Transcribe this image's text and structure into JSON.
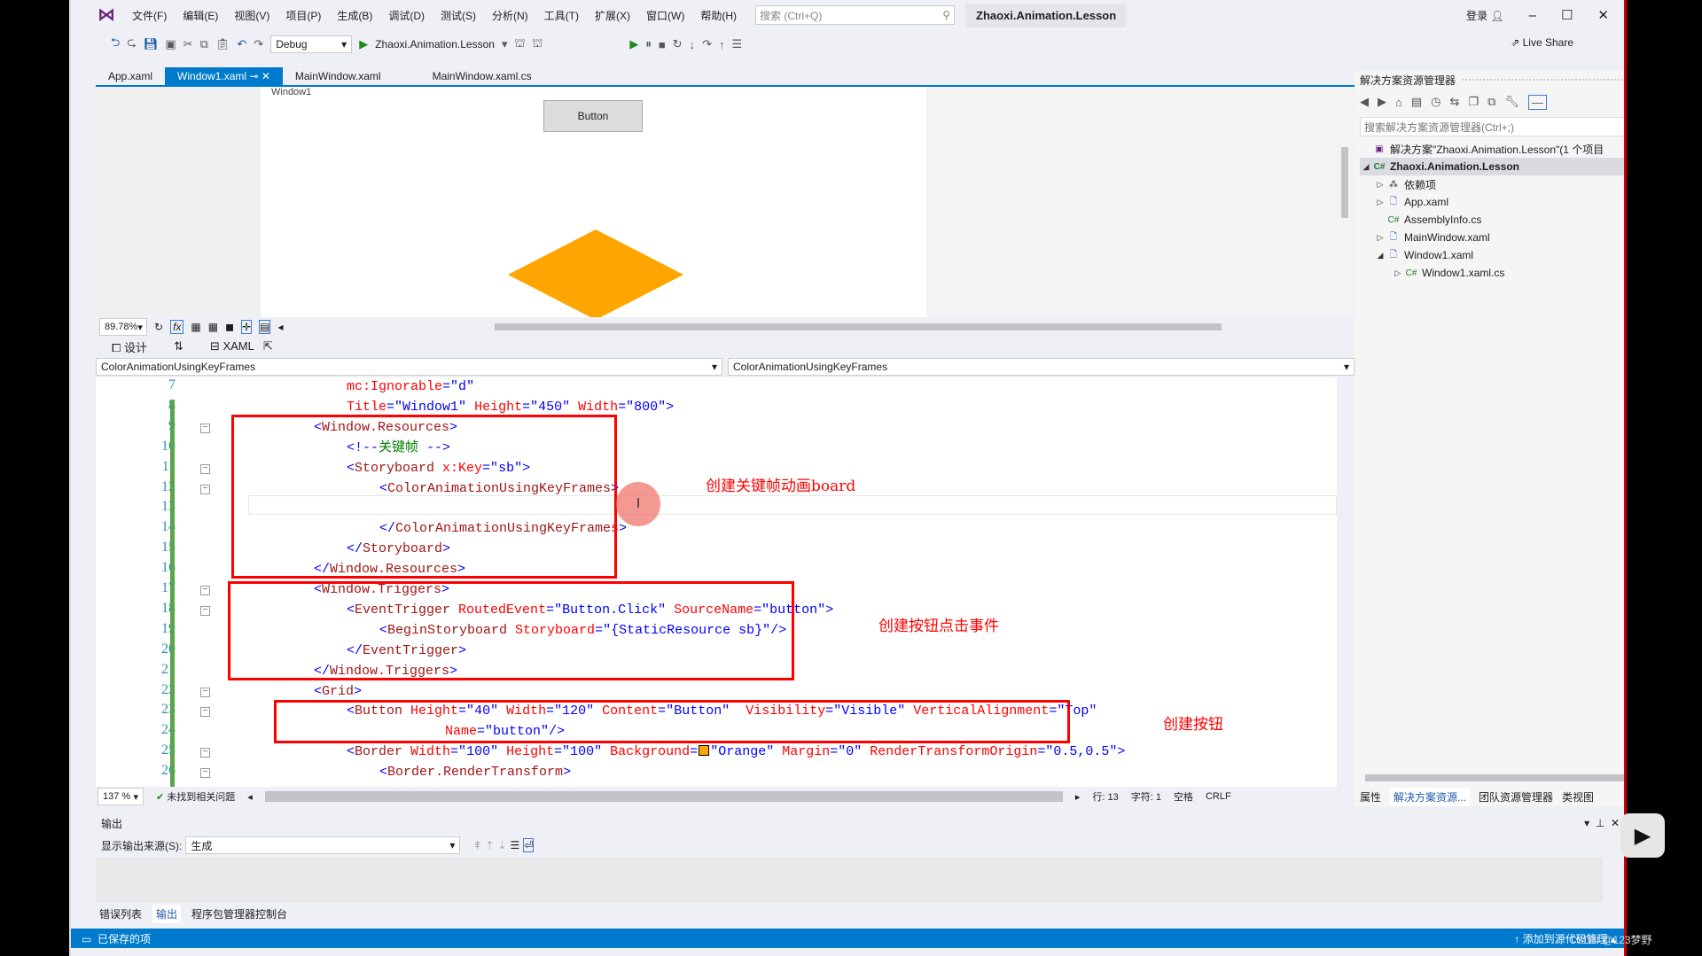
{
  "titlebar": {
    "menus": [
      "文件(F)",
      "编辑(E)",
      "视图(V)",
      "项目(P)",
      "生成(B)",
      "调试(D)",
      "测试(S)",
      "分析(N)",
      "工具(T)",
      "扩展(X)",
      "窗口(W)",
      "帮助(H)"
    ],
    "search_placeholder": "搜索 (Ctrl+Q)",
    "project": "Zhaoxi.Animation.Lesson",
    "login": "登录"
  },
  "toolbar": {
    "config": "Debug",
    "startup": "Zhaoxi.Animation.Lesson",
    "live_share": "Live Share"
  },
  "tabs": [
    {
      "label": "App.xaml"
    },
    {
      "label": "Window1.xaml",
      "active": true
    },
    {
      "label": "MainWindow.xaml"
    },
    {
      "label": "MainWindow.xaml.cs"
    }
  ],
  "designer": {
    "window_title": "Window1",
    "button_label": "Button",
    "shape_color": "#ffa500",
    "zoom": "89.78%",
    "design_tab": "设计",
    "xaml_tab": "XAML"
  },
  "nav": {
    "left": "ColorAnimationUsingKeyFrames",
    "right": "ColorAnimationUsingKeyFrames"
  },
  "code": {
    "lines": [
      {
        "n": "7",
        "i": 1,
        "tk": [
          [
            "a",
            "mc:Ignorable"
          ],
          [
            "p",
            "=\""
          ],
          [
            "v",
            "d"
          ],
          [
            "p",
            "\""
          ]
        ]
      },
      {
        "n": "8",
        "i": 1,
        "tk": [
          [
            "a",
            "Title"
          ],
          [
            "p",
            "=\""
          ],
          [
            "v",
            "Window1"
          ],
          [
            "p",
            "\" "
          ],
          [
            "a",
            "Height"
          ],
          [
            "p",
            "=\""
          ],
          [
            "v",
            "450"
          ],
          [
            "p",
            "\" "
          ],
          [
            "a",
            "Width"
          ],
          [
            "p",
            "=\""
          ],
          [
            "v",
            "800"
          ],
          [
            "p",
            "\">"
          ]
        ]
      },
      {
        "n": "9",
        "i": 0,
        "f": 1,
        "tk": [
          [
            "p",
            "<"
          ],
          [
            "t",
            "Window.Resources"
          ],
          [
            "p",
            ">"
          ]
        ]
      },
      {
        "n": "10",
        "i": 1,
        "tk": [
          [
            "p",
            "<!--"
          ],
          [
            "c",
            "关键帧 "
          ],
          [
            "p",
            "-->"
          ]
        ]
      },
      {
        "n": "11",
        "i": 1,
        "f": 1,
        "tk": [
          [
            "p",
            "<"
          ],
          [
            "t",
            "Storyboard"
          ],
          [
            "a",
            " x:Key"
          ],
          [
            "p",
            "=\""
          ],
          [
            "v",
            "sb"
          ],
          [
            "p",
            "\">"
          ]
        ]
      },
      {
        "n": "12",
        "i": 2,
        "f": 1,
        "tk": [
          [
            "p",
            "<"
          ],
          [
            "t",
            "ColorAnimationUsingKeyFrames"
          ],
          [
            "p",
            ">"
          ]
        ]
      },
      {
        "n": "13",
        "i": 2,
        "tk": []
      },
      {
        "n": "14",
        "i": 2,
        "tk": [
          [
            "p",
            "</"
          ],
          [
            "t",
            "ColorAnimationUsingKeyFrames"
          ],
          [
            "p",
            ">"
          ]
        ]
      },
      {
        "n": "15",
        "i": 1,
        "tk": [
          [
            "p",
            "</"
          ],
          [
            "t",
            "Storyboard"
          ],
          [
            "p",
            ">"
          ]
        ]
      },
      {
        "n": "16",
        "i": 0,
        "tk": [
          [
            "p",
            "</"
          ],
          [
            "t",
            "Window.Resources"
          ],
          [
            "p",
            ">"
          ]
        ]
      },
      {
        "n": "17",
        "i": 0,
        "f": 1,
        "tk": [
          [
            "p",
            "<"
          ],
          [
            "t",
            "Window.Triggers"
          ],
          [
            "p",
            ">"
          ]
        ]
      },
      {
        "n": "18",
        "i": 1,
        "f": 1,
        "tk": [
          [
            "p",
            "<"
          ],
          [
            "t",
            "EventTrigger"
          ],
          [
            "a",
            " RoutedEvent"
          ],
          [
            "p",
            "=\""
          ],
          [
            "v",
            "Button.Click"
          ],
          [
            "p",
            "\" "
          ],
          [
            "a",
            "SourceName"
          ],
          [
            "p",
            "=\""
          ],
          [
            "v",
            "button"
          ],
          [
            "p",
            "\">"
          ]
        ]
      },
      {
        "n": "19",
        "i": 2,
        "tk": [
          [
            "p",
            "<"
          ],
          [
            "t",
            "BeginStoryboard"
          ],
          [
            "a",
            " Storyboard"
          ],
          [
            "p",
            "=\""
          ],
          [
            "v",
            "{StaticResource sb}"
          ],
          [
            "p",
            "\"/>"
          ]
        ]
      },
      {
        "n": "20",
        "i": 1,
        "tk": [
          [
            "p",
            "</"
          ],
          [
            "t",
            "EventTrigger"
          ],
          [
            "p",
            ">"
          ]
        ]
      },
      {
        "n": "21",
        "i": 0,
        "tk": [
          [
            "p",
            "</"
          ],
          [
            "t",
            "Window.Triggers"
          ],
          [
            "p",
            ">"
          ]
        ]
      },
      {
        "n": "22",
        "i": 0,
        "f": 1,
        "tk": [
          [
            "p",
            "<"
          ],
          [
            "t",
            "Grid"
          ],
          [
            "p",
            ">"
          ]
        ]
      },
      {
        "n": "23",
        "i": 1,
        "f": 1,
        "tk": [
          [
            "p",
            "<"
          ],
          [
            "t",
            "Button"
          ],
          [
            "a",
            " Height"
          ],
          [
            "p",
            "=\""
          ],
          [
            "v",
            "40"
          ],
          [
            "p",
            "\" "
          ],
          [
            "a",
            "Width"
          ],
          [
            "p",
            "=\""
          ],
          [
            "v",
            "120"
          ],
          [
            "p",
            "\" "
          ],
          [
            "a",
            "Content"
          ],
          [
            "p",
            "=\""
          ],
          [
            "v",
            "Button"
          ],
          [
            "p",
            "\"  "
          ],
          [
            "a",
            "Visibility"
          ],
          [
            "p",
            "=\""
          ],
          [
            "v",
            "Visible"
          ],
          [
            "p",
            "\" "
          ],
          [
            "a",
            "VerticalAlignment"
          ],
          [
            "p",
            "=\""
          ],
          [
            "v",
            "Top"
          ],
          [
            "p",
            "\""
          ]
        ]
      },
      {
        "n": "24",
        "i": 4,
        "tk": [
          [
            "a",
            "Name"
          ],
          [
            "p",
            "=\""
          ],
          [
            "v",
            "button"
          ],
          [
            "p",
            "\"/>"
          ]
        ]
      },
      {
        "n": "25",
        "i": 1,
        "f": 1,
        "tk": [
          [
            "p",
            "<"
          ],
          [
            "t",
            "Border"
          ],
          [
            "a",
            " Width"
          ],
          [
            "p",
            "=\""
          ],
          [
            "v",
            "100"
          ],
          [
            "p",
            "\" "
          ],
          [
            "a",
            "Height"
          ],
          [
            "p",
            "=\""
          ],
          [
            "v",
            "100"
          ],
          [
            "p",
            "\" "
          ],
          [
            "a",
            "Background"
          ],
          [
            "p",
            "="
          ],
          [
            "s",
            ""
          ],
          [
            "p",
            "\""
          ],
          [
            "v",
            "Orange"
          ],
          [
            "p",
            "\" "
          ],
          [
            "a",
            "Margin"
          ],
          [
            "p",
            "=\""
          ],
          [
            "v",
            "0"
          ],
          [
            "p",
            "\" "
          ],
          [
            "a",
            "RenderTransformOrigin"
          ],
          [
            "p",
            "=\""
          ],
          [
            "v",
            "0.5,0.5"
          ],
          [
            "p",
            "\">"
          ]
        ]
      },
      {
        "n": "26",
        "i": 2,
        "f": 1,
        "tk": [
          [
            "p",
            "<"
          ],
          [
            "t",
            "Border.RenderTransform"
          ],
          [
            "p",
            ">"
          ]
        ]
      }
    ]
  },
  "annotations": [
    "创建关键帧动画board",
    "创建按钮点击事件",
    "创建按钮"
  ],
  "code_status": {
    "zoom": "137 %",
    "issues": "未找到相关问题",
    "line": "行: 13",
    "char": "字符: 1",
    "spaces": "空格",
    "eol": "CRLF"
  },
  "solution_explorer": {
    "title": "解决方案资源管理器",
    "search_placeholder": "搜索解决方案资源管理器(Ctrl+;)",
    "items": [
      {
        "label": "解决方案\"Zhaoxi.Animation.Lesson\"(1 个项目"
      },
      {
        "label": "Zhaoxi.Animation.Lesson"
      },
      {
        "label": "依赖项"
      },
      {
        "label": "App.xaml"
      },
      {
        "label": "AssemblyInfo.cs"
      },
      {
        "label": "MainWindow.xaml"
      },
      {
        "label": "Window1.xaml"
      },
      {
        "label": "Window1.xaml.cs"
      }
    ],
    "bottom_tabs": [
      "属性",
      "解决方案资源...",
      "团队资源管理器",
      "类视图"
    ]
  },
  "output": {
    "title": "输出",
    "source_label": "显示输出来源(S):",
    "source_value": "生成",
    "tabs": [
      "错误列表",
      "输出",
      "程序包管理器控制台"
    ]
  },
  "statusbar": {
    "left": "已保存的项",
    "right": "添加到源代码管理 ▴",
    "watermark": "CSDN @123梦野"
  }
}
